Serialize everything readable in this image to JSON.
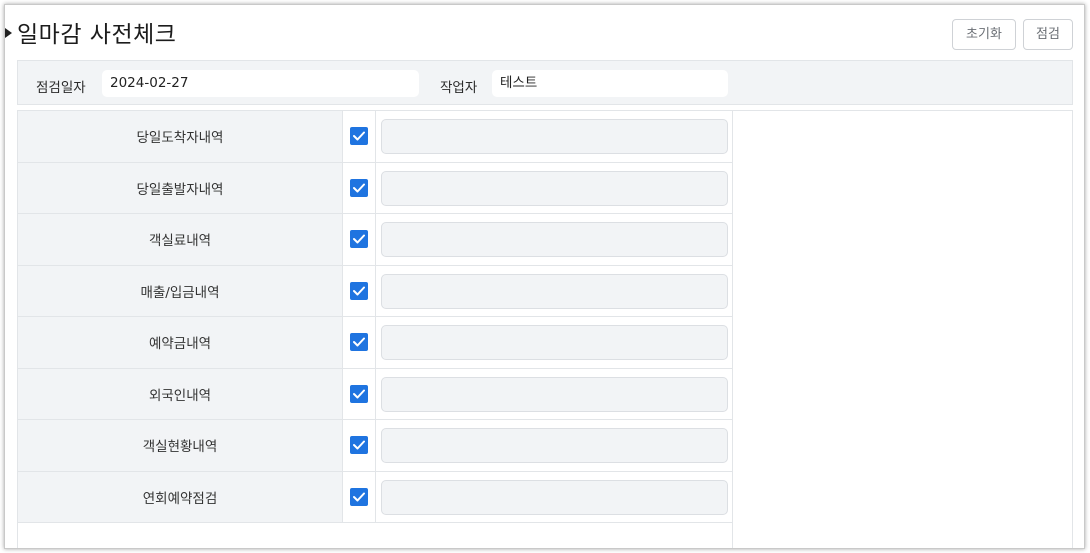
{
  "page": {
    "title": "일마감 사전체크"
  },
  "toolbar": {
    "reset_label": "초기화",
    "check_label": "점검"
  },
  "filter": {
    "date_label": "점검일자",
    "date_value": "2024-02-27",
    "worker_label": "작업자",
    "worker_value": "테스트"
  },
  "checklist": [
    {
      "label": "당일도착자내역",
      "checked": true,
      "note": ""
    },
    {
      "label": "당일출발자내역",
      "checked": true,
      "note": ""
    },
    {
      "label": "객실료내역",
      "checked": true,
      "note": ""
    },
    {
      "label": "매출/입금내역",
      "checked": true,
      "note": ""
    },
    {
      "label": "예약금내역",
      "checked": true,
      "note": ""
    },
    {
      "label": "외국인내역",
      "checked": true,
      "note": ""
    },
    {
      "label": "객실현황내역",
      "checked": true,
      "note": ""
    },
    {
      "label": "연회예약점검",
      "checked": true,
      "note": ""
    }
  ],
  "colors": {
    "accent": "#1f74e0",
    "panel_bg": "#f2f4f6",
    "border": "#e2e5e8"
  }
}
